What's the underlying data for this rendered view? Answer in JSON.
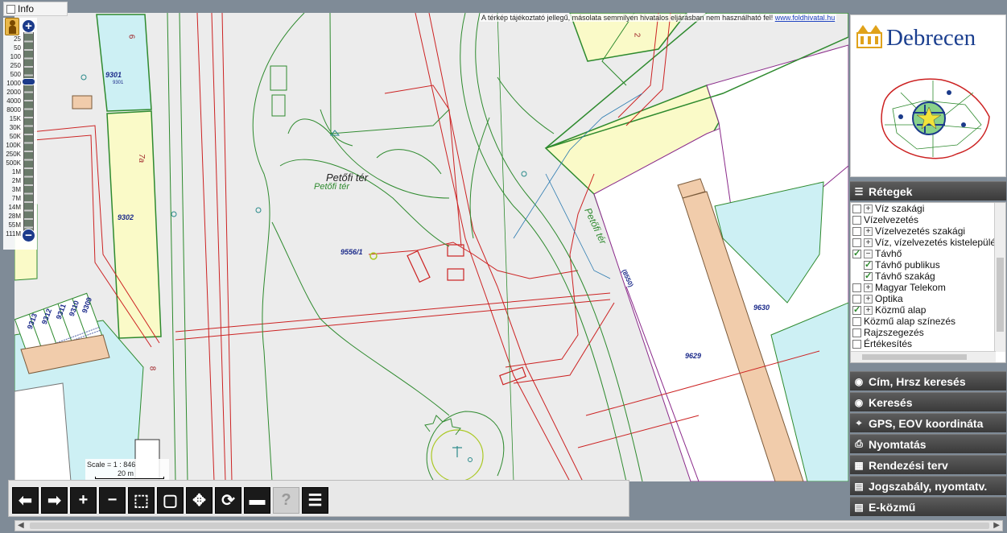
{
  "info": {
    "label": "Info"
  },
  "disclaimer": {
    "text": "A térkép tájékoztató jellegű, másolata semmilyen hivatalos eljárásban nem használható fel!",
    "link": "www.foldhivatal.hu"
  },
  "zoom": {
    "levels": [
      "25",
      "50",
      "100",
      "250",
      "500",
      "1000",
      "2000",
      "4000",
      "8000",
      "15K",
      "30K",
      "50K",
      "100K",
      "250K",
      "500K",
      "1M",
      "2M",
      "3M",
      "7M",
      "14M",
      "28M",
      "55M",
      "111M"
    ],
    "plus_label": "+",
    "minus_label": "−"
  },
  "scale": {
    "ratio_text": "Scale = 1 : 846",
    "bar_text": "20 m"
  },
  "map_labels": {
    "place1": "Petőfi tér",
    "place2": "Petőfi tér",
    "place3": "Petőfi tér",
    "parcel_9556": "9556/1",
    "parcel_9301": "9301",
    "parcel_9301_small": "9301",
    "parcel_9302": "9302",
    "parcel_9630": "9630",
    "parcel_9629": "9629",
    "parcel_7a": "7a",
    "parcel_6": "6",
    "parcel_8": "8",
    "parcel_2": "2",
    "parcel_8550": "(8550)",
    "stack": [
      "9309",
      "9310",
      "9311",
      "9312",
      "9313"
    ]
  },
  "logo": {
    "text": "Debrecen"
  },
  "panels": {
    "layers_title": "Rétegek",
    "addr_search": "Cím, Hrsz keresés",
    "search": "Keresés",
    "gps": "GPS, EOV koordináta",
    "print": "Nyomtatás",
    "plan": "Rendezési terv",
    "law": "Jogszabály, nyomtatv.",
    "ekozmu": "E-közmű"
  },
  "layers": [
    {
      "label": "Víz szakági",
      "checked": false,
      "expand": "+",
      "sub": false
    },
    {
      "label": "Vízelvezetés",
      "checked": false,
      "expand": "",
      "sub": false
    },
    {
      "label": "Vízelvezetés szakági",
      "checked": false,
      "expand": "+",
      "sub": false
    },
    {
      "label": "Víz, vízelvezetés kistelepülés",
      "checked": false,
      "expand": "+",
      "sub": false
    },
    {
      "label": "Távhő",
      "checked": true,
      "expand": "−",
      "sub": false
    },
    {
      "label": "Távhő publikus",
      "checked": true,
      "expand": "",
      "sub": true
    },
    {
      "label": "Távhő szakág",
      "checked": true,
      "expand": "",
      "sub": true
    },
    {
      "label": "Magyar Telekom",
      "checked": false,
      "expand": "+",
      "sub": false
    },
    {
      "label": "Optika",
      "checked": false,
      "expand": "+",
      "sub": false
    },
    {
      "label": "Közmű alap",
      "checked": true,
      "expand": "+",
      "sub": false
    },
    {
      "label": "Közmű alap színezés",
      "checked": false,
      "expand": "",
      "sub": false
    },
    {
      "label": "Rajzszegezés",
      "checked": false,
      "expand": "",
      "sub": false
    },
    {
      "label": "Értékesítés",
      "checked": false,
      "expand": "",
      "sub": false
    }
  ],
  "toolbar": [
    {
      "name": "back-button",
      "glyph": "⬅"
    },
    {
      "name": "forward-button",
      "glyph": "➡"
    },
    {
      "name": "zoom-in-button",
      "glyph": "+"
    },
    {
      "name": "zoom-out-button",
      "glyph": "−"
    },
    {
      "name": "zoom-box-button",
      "glyph": "⬚"
    },
    {
      "name": "full-extent-button",
      "glyph": "▢"
    },
    {
      "name": "pan-button",
      "glyph": "✥"
    },
    {
      "name": "refresh-button",
      "glyph": "⟳"
    },
    {
      "name": "measure-button",
      "glyph": "▬"
    },
    {
      "name": "help-button",
      "glyph": "?",
      "disabled": true
    },
    {
      "name": "document-button",
      "glyph": "☰"
    }
  ]
}
